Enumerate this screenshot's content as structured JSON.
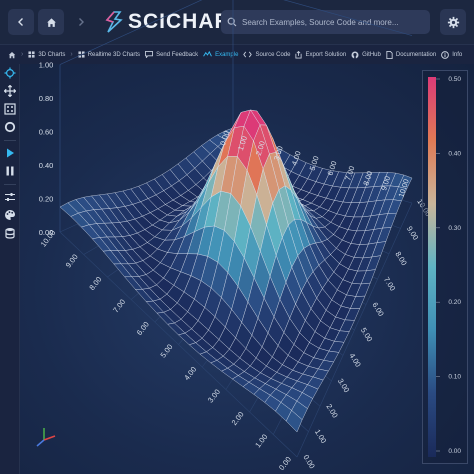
{
  "header": {
    "logo_text": "SCICHART",
    "search_placeholder": "Search Examples, Source Code and more...",
    "icons": [
      "back-icon",
      "home-icon",
      "forward-icon",
      "scichart-logo-icon",
      "search-icon",
      "gear-icon"
    ]
  },
  "breadcrumbs": [
    {
      "label": "3D Charts",
      "icon": "grid-icon"
    },
    {
      "label": "Realtime 3D Charts",
      "icon": "grid-icon"
    },
    {
      "label": "Send Feedback",
      "icon": "feedback-icon"
    },
    {
      "label": "Example",
      "icon": "surface-icon",
      "active": true
    },
    {
      "label": "Source Code",
      "icon": "code-icon"
    },
    {
      "label": "Export Solution",
      "icon": "export-icon"
    },
    {
      "label": "GitHub",
      "icon": "github-icon"
    },
    {
      "label": "Documentation",
      "icon": "doc-icon"
    },
    {
      "label": "Info",
      "icon": "info-icon"
    }
  ],
  "toolbar": {
    "tools": [
      "crosshair-icon",
      "pan-icon",
      "zoom-extents-icon",
      "rotate-icon",
      "play-icon",
      "pause-icon",
      "settings-sliders-icon",
      "palette-icon",
      "database-icon"
    ]
  },
  "chart_data": {
    "type": "surface3d",
    "x_ticks": [
      "0.00",
      "1.00",
      "2.00",
      "3.00",
      "4.00",
      "5.00",
      "6.00",
      "7.00",
      "8.00",
      "9.00",
      "10.00"
    ],
    "z_ticks": [
      "0.00",
      "1.00",
      "2.00",
      "3.00",
      "4.00",
      "5.00",
      "6.00",
      "7.00",
      "8.00",
      "9.00",
      "10.00"
    ],
    "y_ticks": [
      "0.00",
      "0.20",
      "0.40",
      "0.60",
      "0.80",
      "1.00"
    ],
    "colormap_ticks": [
      "0.50",
      "0.40",
      "0.30",
      "0.20",
      "0.10",
      "0.00"
    ],
    "colormap_range": [
      0,
      0.5
    ],
    "colormap_colors": [
      "#1a2a5a",
      "#2a4a82",
      "#3f8fb5",
      "#5fb4c4",
      "#c9b59a",
      "#e07a55",
      "#dc3a77"
    ],
    "grid": true,
    "surface_peak": 0.5,
    "surface_peak_at": [
      5,
      5
    ]
  }
}
